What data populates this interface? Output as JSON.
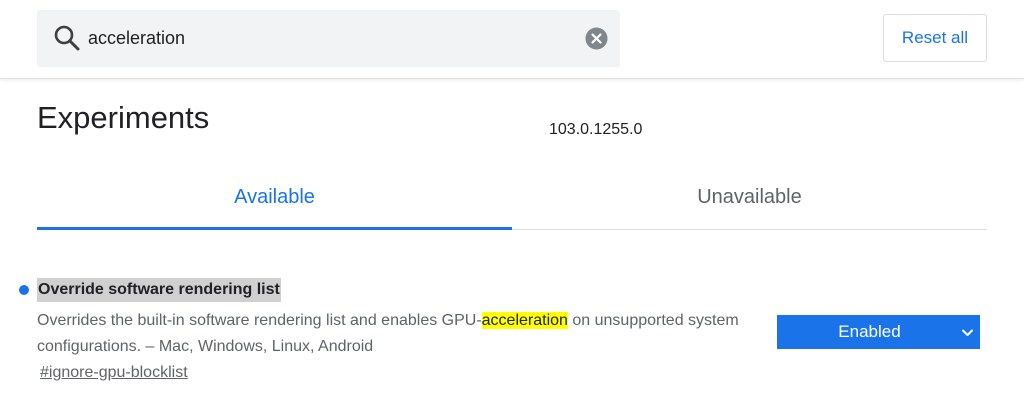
{
  "search": {
    "value": "acceleration",
    "clear_icon": "close-circle-icon",
    "search_icon": "search-icon"
  },
  "header": {
    "reset_label": "Reset all"
  },
  "main": {
    "title": "Experiments",
    "version": "103.0.1255.0",
    "tabs": [
      {
        "label": "Available",
        "selected": true
      },
      {
        "label": "Unavailable",
        "selected": false
      }
    ]
  },
  "experiment": {
    "title": "Override software rendering list",
    "desc_before": "Overrides the built-in software rendering list and enables GPU-",
    "desc_match": "acceleration",
    "desc_after": " on unsupported system configurations. – Mac, Windows, Linux, Android",
    "link": "#ignore-gpu-blocklist",
    "selected_option": "Enabled"
  },
  "colors": {
    "accent": "#1a73e8",
    "highlight": "#ffff00",
    "search_bg": "#f1f3f4"
  }
}
